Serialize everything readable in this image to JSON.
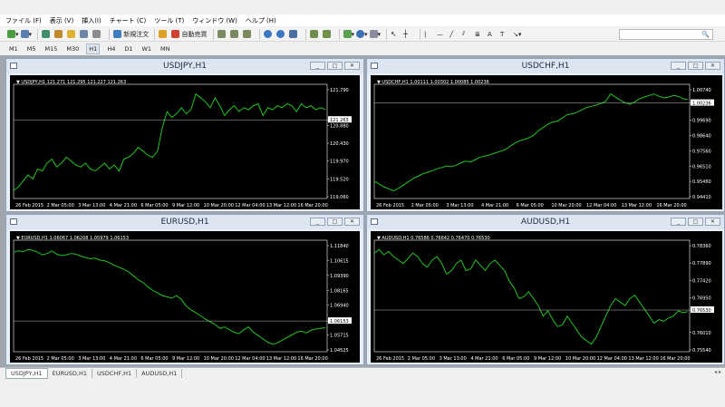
{
  "menu": [
    "ファイル (F)",
    "表示 (V)",
    "挿入(I)",
    "チャート (C)",
    "ツール (T)",
    "ウィンドウ (W)",
    "ヘルプ (H)"
  ],
  "toolbar": {
    "new_order": "新規注文",
    "auto_trading": "自動売買"
  },
  "timeframes": [
    "M1",
    "M5",
    "M15",
    "M30",
    "H1",
    "H4",
    "D1",
    "W1",
    "MN"
  ],
  "active_timeframe": "H1",
  "windows": [
    {
      "title": "USDJPY,H1",
      "info": "USDJPY,H1  121.271 121.295 121.227 121.263",
      "price_labels": [
        "121.790",
        "121.263",
        "120.880",
        "120.430",
        "119.970",
        "119.520",
        "119.060"
      ],
      "current": "121.263",
      "current_frac": 0.3,
      "x_labels": [
        "26 Feb 2015",
        "2 Mar 05:00",
        "3 Mar 13:00",
        "4 Mar 21:00",
        "6 Mar 05:00",
        "9 Mar 12:00",
        "10 Mar 20:00",
        "12 Mar 04:00",
        "13 Mar 12:00",
        "16 Mar 20:00"
      ],
      "series": [
        119.2,
        119.3,
        119.45,
        119.6,
        119.5,
        119.75,
        119.7,
        119.9,
        120.0,
        119.8,
        119.9,
        120.05,
        119.95,
        119.85,
        119.8,
        119.9,
        119.75,
        119.7,
        119.8,
        119.9,
        119.75,
        119.85,
        119.7,
        120.0,
        120.05,
        120.15,
        120.3,
        120.2,
        120.1,
        120.05,
        120.2,
        120.8,
        121.2,
        121.05,
        121.15,
        121.3,
        121.15,
        121.25,
        121.65,
        121.55,
        121.45,
        121.3,
        121.55,
        121.35,
        121.1,
        121.25,
        121.35,
        121.2,
        121.3,
        121.25,
        121.35,
        121.4,
        121.1,
        121.3,
        121.25,
        121.35,
        121.3,
        121.4,
        121.35,
        121.2,
        121.4,
        121.3,
        121.35,
        121.25,
        121.3,
        121.26
      ]
    },
    {
      "title": "USDCHF,H1",
      "info": "USDCHF,H1  1.00111 1.00302 1.00085 1.00236",
      "price_labels": [
        "1.00740",
        "1.00236",
        "0.99690",
        "0.98640",
        "0.97560",
        "0.96510",
        "0.95460",
        "0.94410"
      ],
      "current": "1.00236",
      "current_frac": 0.15,
      "x_labels": [
        "26 Feb 2015",
        "2 Mar 05:00",
        "3 Mar 13:00",
        "4 Mar 21:00",
        "6 Mar 05:00",
        "10 Mar 20:00",
        "12 Mar 04:00",
        "13 Mar 12:00",
        "16 Mar 20:00"
      ],
      "series": [
        0.9515,
        0.9498,
        0.948,
        0.9467,
        0.9455,
        0.947,
        0.949,
        0.951,
        0.953,
        0.9545,
        0.956,
        0.957,
        0.958,
        0.9592,
        0.96,
        0.961,
        0.9605,
        0.9615,
        0.963,
        0.964,
        0.9635,
        0.965,
        0.9665,
        0.9672,
        0.968,
        0.969,
        0.97,
        0.971,
        0.973,
        0.975,
        0.9765,
        0.9775,
        0.9785,
        0.98,
        0.983,
        0.985,
        0.987,
        0.9885,
        0.989,
        0.991,
        0.993,
        0.9935,
        0.9945,
        0.996,
        0.9975,
        0.9982,
        0.999,
        1.0,
        1.0015,
        1.006,
        1.004,
        1.002,
        1.0005,
        0.9995,
        1.001,
        1.003,
        1.004,
        1.005,
        1.006,
        1.0045,
        1.0035,
        1.004,
        1.005,
        1.0045,
        1.003,
        1.0024
      ]
    },
    {
      "title": "EURUSD,H1",
      "info": "EURUSD,H1  1.06067 1.06208 1.05979 1.06153",
      "price_labels": [
        "1.11840",
        "1.10615",
        "1.09390",
        "1.08165",
        "1.06940",
        "1.06153",
        "1.05715",
        "1.04525"
      ],
      "current": "1.06153",
      "current_frac": 0.72,
      "x_labels": [
        "26 Feb 2015",
        "2 Mar 05:00",
        "3 Mar 13:00",
        "4 Mar 21:00",
        "6 Mar 05:00",
        "9 Mar 12:00",
        "10 Mar 20:00",
        "12 Mar 04:00",
        "13 Mar 12:00",
        "16 Mar 20:00"
      ],
      "series": [
        1.119,
        1.12,
        1.1195,
        1.121,
        1.1205,
        1.119,
        1.117,
        1.118,
        1.12,
        1.1175,
        1.1165,
        1.117,
        1.118,
        1.1175,
        1.116,
        1.115,
        1.114,
        1.1145,
        1.113,
        1.1125,
        1.111,
        1.109,
        1.1075,
        1.106,
        1.104,
        1.101,
        1.098,
        1.096,
        1.0925,
        1.09,
        1.088,
        1.086,
        1.085,
        1.084,
        1.086,
        1.083,
        1.078,
        1.075,
        1.073,
        1.0705,
        1.068,
        1.066,
        1.064,
        1.061,
        1.062,
        1.06,
        1.058,
        1.057,
        1.06,
        1.062,
        1.058,
        1.0555,
        1.053,
        1.0505,
        1.049,
        1.05,
        1.052,
        1.054,
        1.056,
        1.058,
        1.059,
        1.0575,
        1.0595,
        1.0605,
        1.061,
        1.0615
      ]
    },
    {
      "title": "AUDUSD,H1",
      "info": "AUDUSD,H1  0.76586 0.76642 0.76470 0.76530",
      "price_labels": [
        "0.78360",
        "0.77890",
        "0.77420",
        "0.76950",
        "0.76530",
        "0.76010",
        "0.75540"
      ],
      "current": "0.76530",
      "current_frac": 0.62,
      "x_labels": [
        "26 Feb 2015",
        "2 Mar 05:00",
        "3 Mar 13:00",
        "4 Mar 21:00",
        "6 Mar 05:00",
        "9 Mar 12:00",
        "10 Mar 20:00",
        "12 Mar 04:00",
        "13 Mar 12:00",
        "16 Mar 20:00"
      ],
      "series": [
        0.782,
        0.783,
        0.7815,
        0.7825,
        0.781,
        0.78,
        0.779,
        0.7805,
        0.782,
        0.781,
        0.779,
        0.778,
        0.78,
        0.781,
        0.779,
        0.776,
        0.777,
        0.779,
        0.78,
        0.777,
        0.7775,
        0.78,
        0.7785,
        0.777,
        0.779,
        0.78,
        0.7785,
        0.777,
        0.774,
        0.772,
        0.769,
        0.7695,
        0.771,
        0.769,
        0.767,
        0.764,
        0.7655,
        0.763,
        0.761,
        0.7615,
        0.764,
        0.762,
        0.76,
        0.758,
        0.757,
        0.756,
        0.758,
        0.761,
        0.764,
        0.767,
        0.769,
        0.768,
        0.767,
        0.769,
        0.77,
        0.768,
        0.766,
        0.764,
        0.762,
        0.763,
        0.7625,
        0.7635,
        0.764,
        0.7655,
        0.765,
        0.7653
      ]
    }
  ],
  "chart_tabs": [
    "USDJPY,H1",
    "EURUSD,H1",
    "USDCHF,H1",
    "AUDUSD,H1"
  ],
  "colors": {
    "line": "#1fc41f",
    "axis_text": "#ffffff",
    "current_line": "#c0c0c0"
  }
}
